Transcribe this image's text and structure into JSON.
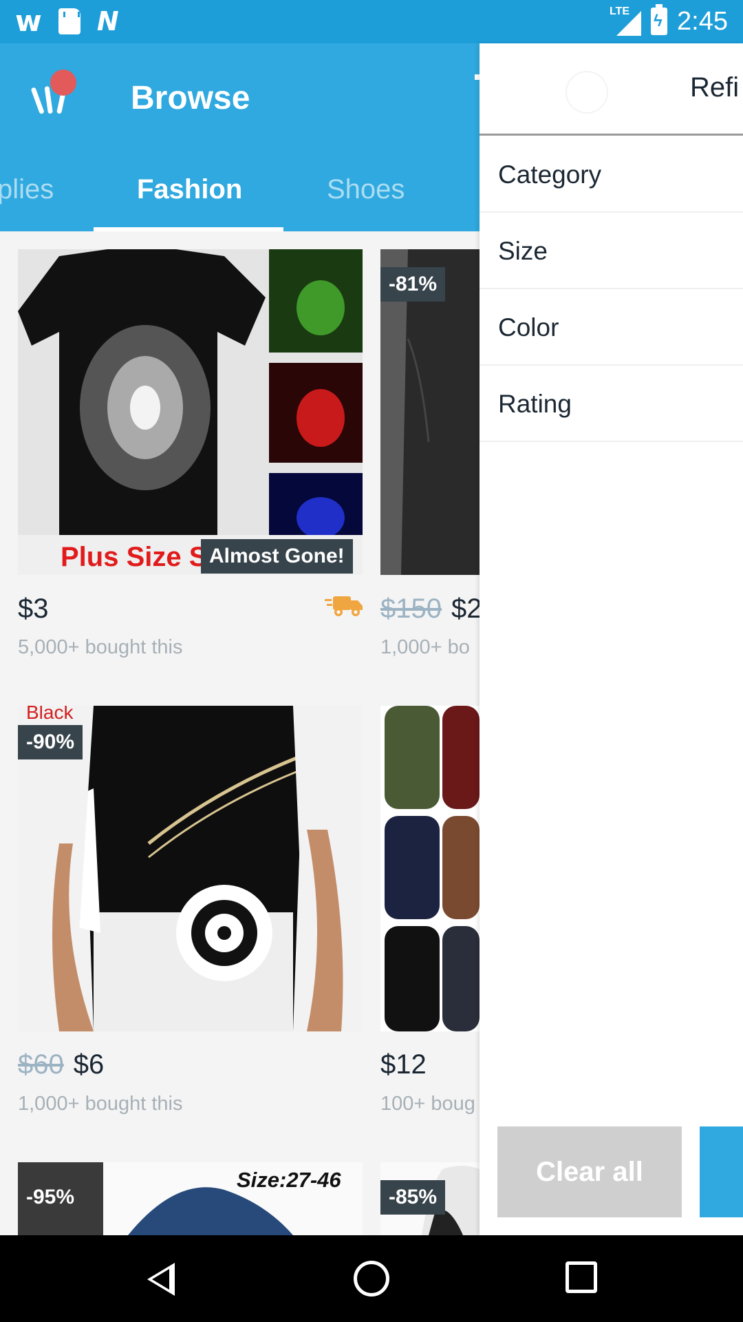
{
  "status_bar": {
    "network_label": "LTE",
    "time": "2:45",
    "icons": [
      "wish-notification-icon",
      "sd-card-icon",
      "n-notification-icon",
      "lte-signal-icon",
      "battery-charging-icon"
    ]
  },
  "header": {
    "title": "Browse",
    "logo_icon": "wish-logo-icon",
    "accent_color": "#2fa9df"
  },
  "tabs": [
    {
      "label": "plies"
    },
    {
      "label": "Fashion"
    },
    {
      "label": "Shoes"
    }
  ],
  "active_tab": "Fashion",
  "products": [
    {
      "badge": "",
      "overlay_text": "Plus Size S-",
      "stock_label": "Almost Gone!",
      "original_price": "",
      "price": "$3",
      "bought": "5,000+ bought this",
      "shipping_icon": "fast-shipping-truck-icon"
    },
    {
      "badge": "-81%",
      "overlay_text": "",
      "stock_label": "",
      "original_price": "$150",
      "price": "$2",
      "bought": "1,000+ bo"
    },
    {
      "badge": "-90%",
      "overlay_text": "Black",
      "stock_label": "",
      "original_price": "$60",
      "price": "$6",
      "bought": "1,000+ bought this"
    },
    {
      "badge": "",
      "overlay_text": "",
      "stock_label": "",
      "original_price": "",
      "price": "$12",
      "bought": "100+ boug"
    },
    {
      "badge": "-95%",
      "overlay_text": "Size:27-46",
      "stock_label": "",
      "original_price": "",
      "price": "",
      "bought": ""
    },
    {
      "badge": "-85%",
      "overlay_text": "",
      "stock_label": "",
      "original_price": "",
      "price": "",
      "bought": ""
    }
  ],
  "refine_drawer": {
    "title": "Refi",
    "filters": [
      "Category",
      "Size",
      "Color",
      "Rating"
    ],
    "clear_label": "Clear all"
  },
  "nav_bar": {
    "icons": [
      "back-icon",
      "home-icon",
      "recents-icon"
    ]
  }
}
